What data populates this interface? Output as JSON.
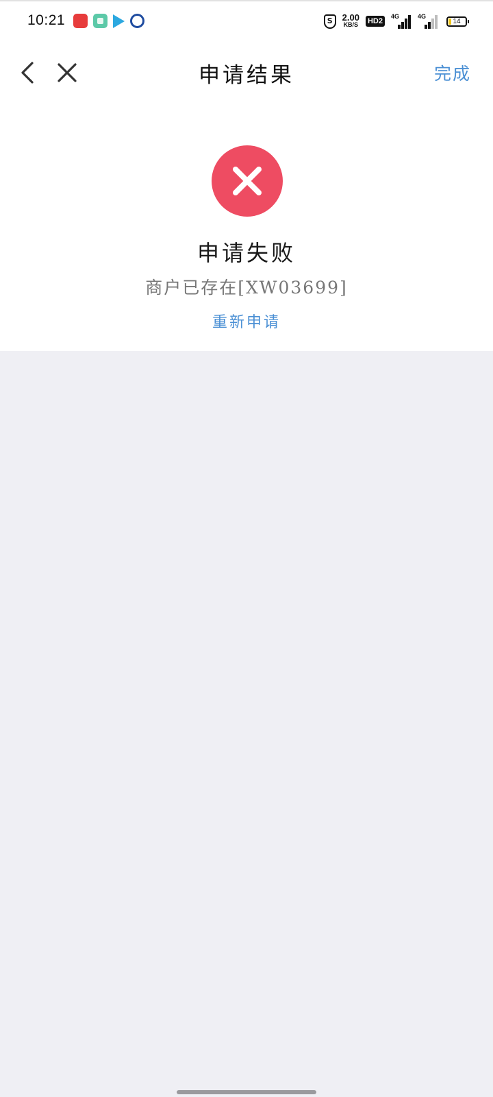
{
  "status_bar": {
    "time": "10:21",
    "shield_glyph": "S",
    "net_speed_value": "2.00",
    "net_speed_unit": "KB/S",
    "hd_badge": "HD2",
    "sim1_label": "4G",
    "sim2_label": "4G",
    "battery_level": "14",
    "notification_icons": [
      "red-app-icon",
      "green-chat-icon",
      "play-icon",
      "blue-circle-app-icon"
    ]
  },
  "nav": {
    "title": "申请结果",
    "done_label": "完成",
    "back_icon": "chevron-left-icon",
    "close_icon": "close-icon"
  },
  "result": {
    "status_icon": "error-circle-icon",
    "title": "申请失败",
    "message": "商户已存在[XW03699]",
    "retry_label": "重新申请"
  },
  "colors": {
    "accent": "#4a8fd4",
    "error": "#ee4c62",
    "page_background": "#efeff4"
  }
}
